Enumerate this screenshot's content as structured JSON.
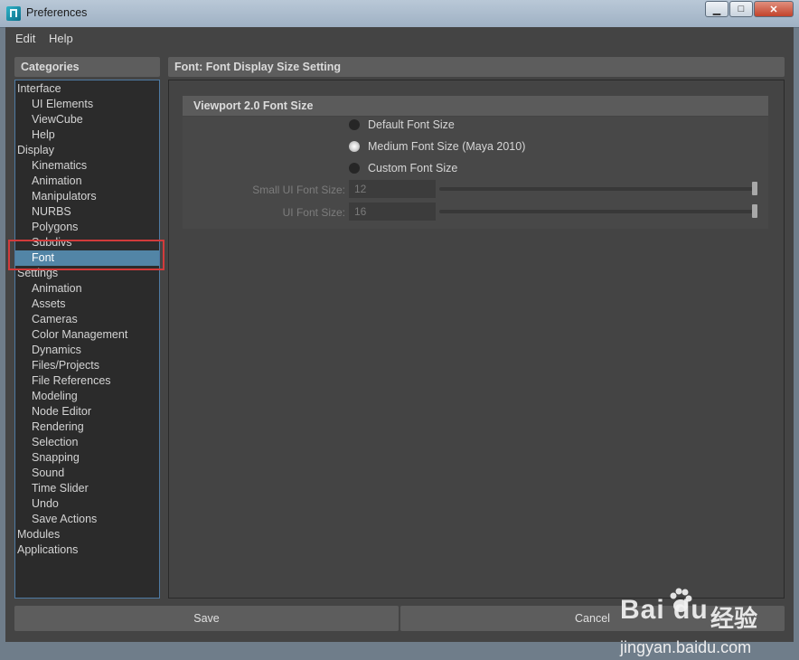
{
  "window": {
    "title": "Preferences",
    "controls": [
      "minimize",
      "maximize",
      "close"
    ]
  },
  "menu": [
    "Edit",
    "Help"
  ],
  "categories": {
    "header": "Categories",
    "items": [
      {
        "label": "Interface",
        "level": 0
      },
      {
        "label": "UI Elements",
        "level": 1
      },
      {
        "label": "ViewCube",
        "level": 1
      },
      {
        "label": "Help",
        "level": 1
      },
      {
        "label": "Display",
        "level": 0
      },
      {
        "label": "Kinematics",
        "level": 1
      },
      {
        "label": "Animation",
        "level": 1
      },
      {
        "label": "Manipulators",
        "level": 1
      },
      {
        "label": "NURBS",
        "level": 1
      },
      {
        "label": "Polygons",
        "level": 1
      },
      {
        "label": "Subdivs",
        "level": 1
      },
      {
        "label": "Font",
        "level": 1,
        "selected": true
      },
      {
        "label": "Settings",
        "level": 0
      },
      {
        "label": "Animation",
        "level": 1
      },
      {
        "label": "Assets",
        "level": 1
      },
      {
        "label": "Cameras",
        "level": 1
      },
      {
        "label": "Color Management",
        "level": 1
      },
      {
        "label": "Dynamics",
        "level": 1
      },
      {
        "label": "Files/Projects",
        "level": 1
      },
      {
        "label": "File References",
        "level": 1
      },
      {
        "label": "Modeling",
        "level": 1
      },
      {
        "label": "Node Editor",
        "level": 1
      },
      {
        "label": "Rendering",
        "level": 1
      },
      {
        "label": "Selection",
        "level": 1
      },
      {
        "label": "Snapping",
        "level": 1
      },
      {
        "label": "Sound",
        "level": 1
      },
      {
        "label": "Time Slider",
        "level": 1
      },
      {
        "label": "Undo",
        "level": 1
      },
      {
        "label": "Save Actions",
        "level": 1
      },
      {
        "label": "Modules",
        "level": 0
      },
      {
        "label": "Applications",
        "level": 0
      }
    ]
  },
  "panel": {
    "title": "Font: Font Display Size Setting",
    "group_title": "Viewport 2.0 Font Size",
    "radio_options": [
      {
        "label": "Default Font Size",
        "selected": false
      },
      {
        "label": "Medium Font Size (Maya 2010)",
        "selected": true
      },
      {
        "label": "Custom Font Size",
        "selected": false
      }
    ],
    "fields": [
      {
        "label": "Small UI Font Size:",
        "value": "12",
        "slider_level": 1.0,
        "enabled": false
      },
      {
        "label": "UI Font Size:",
        "value": "16",
        "slider_level": 1.0,
        "enabled": false
      }
    ]
  },
  "buttons": {
    "save": "Save",
    "cancel": "Cancel"
  },
  "watermark": {
    "brand": "Bai du",
    "brand_cn": "经验",
    "url": "jingyan.baidu.com"
  },
  "colors": {
    "selection": "#5285a6",
    "highlight_box": "#d23b3b"
  }
}
